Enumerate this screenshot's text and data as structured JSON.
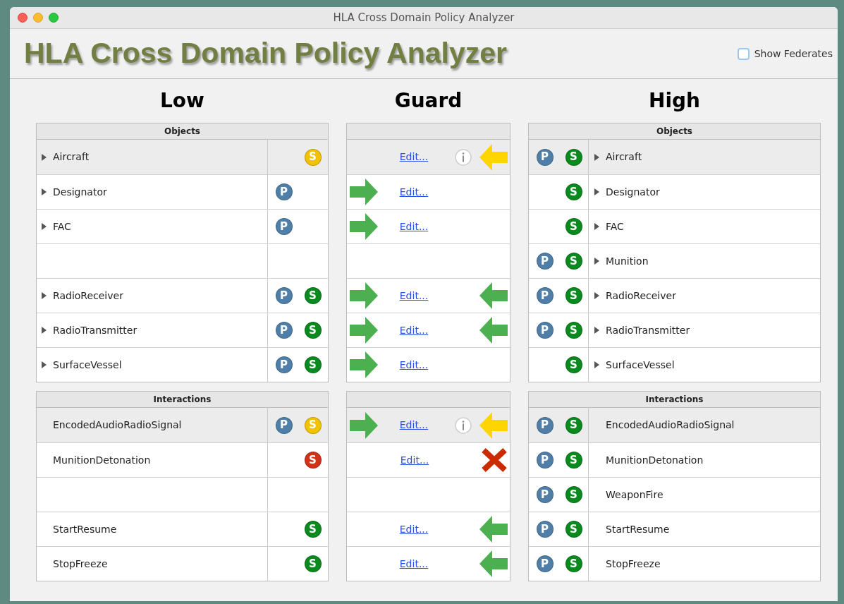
{
  "window": {
    "title": "HLA Cross Domain Policy Analyzer"
  },
  "app_title": "HLA Cross Domain Policy Analyzer",
  "show_federates": {
    "label": "Show Federates",
    "checked": false
  },
  "low": {
    "heading": "Low",
    "sections": [
      {
        "title": "Objects",
        "rows": [
          {
            "name": "Aircraft",
            "expandable": true,
            "selected": true,
            "badges": [
              {
                "kind": "subscribe",
                "letter": "S",
                "color": "#f2c200"
              }
            ]
          },
          {
            "name": "Designator",
            "expandable": true,
            "selected": false,
            "badges": [
              {
                "kind": "publish",
                "letter": "P",
                "color": "#4f7fa8"
              }
            ]
          },
          {
            "name": "FAC",
            "expandable": true,
            "selected": false,
            "badges": [
              {
                "kind": "publish",
                "letter": "P",
                "color": "#4f7fa8"
              }
            ]
          },
          {
            "selected": false,
            "badges": []
          },
          {
            "name": "RadioReceiver",
            "expandable": true,
            "selected": false,
            "badges": [
              {
                "kind": "publish",
                "letter": "P",
                "color": "#4f7fa8"
              },
              {
                "kind": "subscribe",
                "letter": "S",
                "color": "#0a8a1e"
              }
            ]
          },
          {
            "name": "RadioTransmitter",
            "expandable": true,
            "selected": false,
            "badges": [
              {
                "kind": "publish",
                "letter": "P",
                "color": "#4f7fa8"
              },
              {
                "kind": "subscribe",
                "letter": "S",
                "color": "#0a8a1e"
              }
            ]
          },
          {
            "name": "SurfaceVessel",
            "expandable": true,
            "selected": false,
            "badges": [
              {
                "kind": "publish",
                "letter": "P",
                "color": "#4f7fa8"
              },
              {
                "kind": "subscribe",
                "letter": "S",
                "color": "#0a8a1e"
              }
            ]
          }
        ]
      },
      {
        "title": "Interactions",
        "rows": [
          {
            "name": "EncodedAudioRadioSignal",
            "expandable": false,
            "selected": true,
            "badges": [
              {
                "kind": "publish",
                "letter": "P",
                "color": "#4f7fa8"
              },
              {
                "kind": "subscribe",
                "letter": "S",
                "color": "#f2c200"
              }
            ]
          },
          {
            "name": "MunitionDetonation",
            "expandable": false,
            "selected": false,
            "badges": [
              {
                "kind": "subscribe",
                "letter": "S",
                "color": "#d0331a"
              }
            ]
          },
          {
            "selected": false,
            "badges": []
          },
          {
            "name": "StartResume",
            "expandable": false,
            "selected": false,
            "badges": [
              {
                "kind": "subscribe",
                "letter": "S",
                "color": "#0a8a1e"
              }
            ]
          },
          {
            "name": "StopFreeze",
            "expandable": false,
            "selected": false,
            "badges": [
              {
                "kind": "subscribe",
                "letter": "S",
                "color": "#0a8a1e"
              }
            ]
          }
        ]
      }
    ]
  },
  "guard": {
    "heading": "Guard",
    "sections": [
      {
        "rows": [
          {
            "selected": true,
            "link": "Edit...",
            "info": true,
            "right": {
              "kind": "arrow",
              "color": "#ffd500"
            }
          },
          {
            "selected": false,
            "left": {
              "kind": "arrow",
              "color": "#4caf50"
            },
            "link": "Edit...",
            "info": false
          },
          {
            "selected": false,
            "left": {
              "kind": "arrow",
              "color": "#4caf50"
            },
            "link": "Edit...",
            "info": false
          },
          {
            "selected": false,
            "info": false
          },
          {
            "selected": false,
            "left": {
              "kind": "arrow",
              "color": "#4caf50"
            },
            "link": "Edit...",
            "info": false,
            "right": {
              "kind": "arrow",
              "color": "#4caf50"
            }
          },
          {
            "selected": false,
            "left": {
              "kind": "arrow",
              "color": "#4caf50"
            },
            "link": "Edit...",
            "info": false,
            "right": {
              "kind": "arrow",
              "color": "#4caf50"
            }
          },
          {
            "selected": false,
            "left": {
              "kind": "arrow",
              "color": "#4caf50"
            },
            "link": "Edit...",
            "info": false
          }
        ]
      },
      {
        "rows": [
          {
            "selected": true,
            "left": {
              "kind": "arrow",
              "color": "#4caf50"
            },
            "link": "Edit...",
            "info": true,
            "right": {
              "kind": "arrow",
              "color": "#ffd500"
            }
          },
          {
            "selected": false,
            "link": "Edit...",
            "info": false,
            "right": {
              "kind": "cross",
              "color": "#cc2a00"
            }
          },
          {
            "selected": false,
            "info": false
          },
          {
            "selected": false,
            "link": "Edit...",
            "info": false,
            "right": {
              "kind": "arrow",
              "color": "#4caf50"
            }
          },
          {
            "selected": false,
            "link": "Edit...",
            "info": false,
            "right": {
              "kind": "arrow",
              "color": "#4caf50"
            }
          }
        ]
      }
    ]
  },
  "high": {
    "heading": "High",
    "sections": [
      {
        "title": "Objects",
        "rows": [
          {
            "name": "Aircraft",
            "expandable": true,
            "selected": true,
            "badges": [
              {
                "kind": "publish",
                "letter": "P",
                "color": "#4f7fa8"
              },
              {
                "kind": "subscribe",
                "letter": "S",
                "color": "#0a8a1e"
              }
            ]
          },
          {
            "name": "Designator",
            "expandable": true,
            "selected": false,
            "badges": [
              {
                "kind": "subscribe",
                "letter": "S",
                "color": "#0a8a1e"
              }
            ]
          },
          {
            "name": "FAC",
            "expandable": true,
            "selected": false,
            "badges": [
              {
                "kind": "subscribe",
                "letter": "S",
                "color": "#0a8a1e"
              }
            ]
          },
          {
            "name": "Munition",
            "expandable": true,
            "selected": false,
            "badges": [
              {
                "kind": "publish",
                "letter": "P",
                "color": "#4f7fa8"
              },
              {
                "kind": "subscribe",
                "letter": "S",
                "color": "#0a8a1e"
              }
            ]
          },
          {
            "name": "RadioReceiver",
            "expandable": true,
            "selected": false,
            "badges": [
              {
                "kind": "publish",
                "letter": "P",
                "color": "#4f7fa8"
              },
              {
                "kind": "subscribe",
                "letter": "S",
                "color": "#0a8a1e"
              }
            ]
          },
          {
            "name": "RadioTransmitter",
            "expandable": true,
            "selected": false,
            "badges": [
              {
                "kind": "publish",
                "letter": "P",
                "color": "#4f7fa8"
              },
              {
                "kind": "subscribe",
                "letter": "S",
                "color": "#0a8a1e"
              }
            ]
          },
          {
            "name": "SurfaceVessel",
            "expandable": true,
            "selected": false,
            "badges": [
              {
                "kind": "subscribe",
                "letter": "S",
                "color": "#0a8a1e"
              }
            ]
          }
        ]
      },
      {
        "title": "Interactions",
        "rows": [
          {
            "name": "EncodedAudioRadioSignal",
            "expandable": false,
            "selected": true,
            "badges": [
              {
                "kind": "publish",
                "letter": "P",
                "color": "#4f7fa8"
              },
              {
                "kind": "subscribe",
                "letter": "S",
                "color": "#0a8a1e"
              }
            ]
          },
          {
            "name": "MunitionDetonation",
            "expandable": false,
            "selected": false,
            "badges": [
              {
                "kind": "publish",
                "letter": "P",
                "color": "#4f7fa8"
              },
              {
                "kind": "subscribe",
                "letter": "S",
                "color": "#0a8a1e"
              }
            ]
          },
          {
            "name": "WeaponFire",
            "expandable": false,
            "selected": false,
            "badges": [
              {
                "kind": "publish",
                "letter": "P",
                "color": "#4f7fa8"
              },
              {
                "kind": "subscribe",
                "letter": "S",
                "color": "#0a8a1e"
              }
            ]
          },
          {
            "name": "StartResume",
            "expandable": false,
            "selected": false,
            "badges": [
              {
                "kind": "publish",
                "letter": "P",
                "color": "#4f7fa8"
              },
              {
                "kind": "subscribe",
                "letter": "S",
                "color": "#0a8a1e"
              }
            ]
          },
          {
            "name": "StopFreeze",
            "expandable": false,
            "selected": false,
            "badges": [
              {
                "kind": "publish",
                "letter": "P",
                "color": "#4f7fa8"
              },
              {
                "kind": "subscribe",
                "letter": "S",
                "color": "#0a8a1e"
              }
            ]
          }
        ]
      }
    ]
  }
}
